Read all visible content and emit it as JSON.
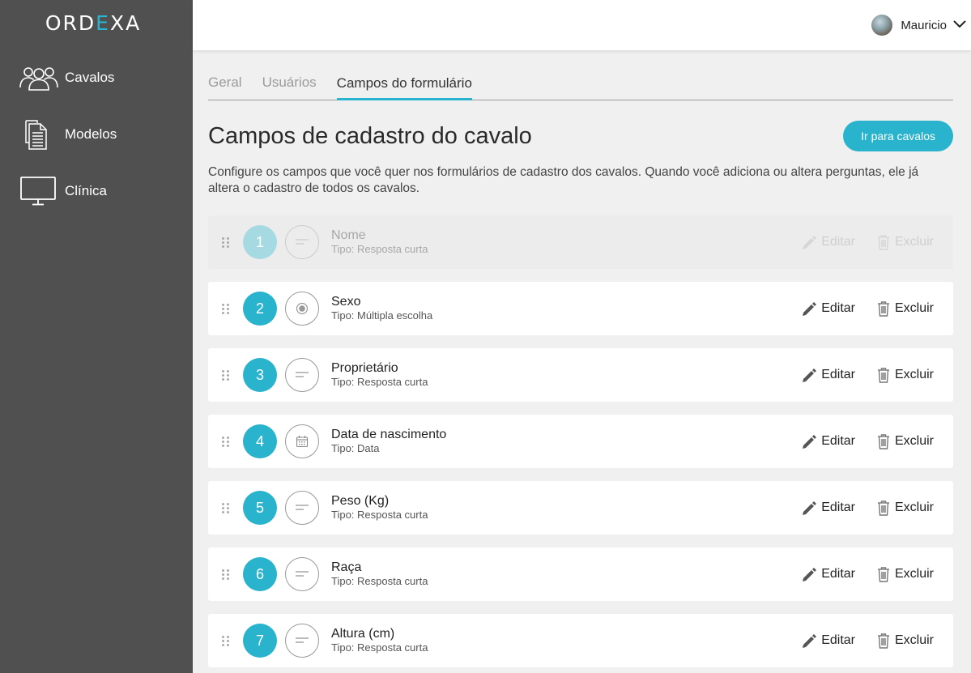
{
  "brand": {
    "logo_part1": "ORD",
    "logo_accent": "E",
    "logo_part2": "XA",
    "accent_color": "#29b3cc"
  },
  "sidebar": {
    "items": [
      {
        "label": "Cavalos",
        "icon": "users-icon"
      },
      {
        "label": "Modelos",
        "icon": "documents-icon"
      },
      {
        "label": "Clínica",
        "icon": "monitor-icon"
      }
    ]
  },
  "topbar": {
    "user_name": "Mauricio"
  },
  "tabs": [
    {
      "label": "Geral",
      "active": false
    },
    {
      "label": "Usuários",
      "active": false
    },
    {
      "label": "Campos do formulário",
      "active": true
    }
  ],
  "main": {
    "title": "Campos de cadastro do cavalo",
    "go_button": "Ir para cavalos",
    "description": "Configure os campos que você quer nos formulários de cadastro dos cavalos. Quando você adiciona ou altera perguntas, ele já altera o cadastro de todos os cavalos."
  },
  "actions": {
    "edit": "Editar",
    "delete": "Excluir"
  },
  "fields": [
    {
      "number": "1",
      "name": "Nome",
      "type": "Tipo: Resposta curta",
      "icon": "short-text-icon",
      "disabled": true
    },
    {
      "number": "2",
      "name": "Sexo",
      "type": "Tipo: Múltipla escolha",
      "icon": "radio-icon",
      "disabled": false
    },
    {
      "number": "3",
      "name": "Proprietário",
      "type": "Tipo: Resposta curta",
      "icon": "short-text-icon",
      "disabled": false
    },
    {
      "number": "4",
      "name": "Data de nascimento",
      "type": "Tipo: Data",
      "icon": "calendar-icon",
      "disabled": false
    },
    {
      "number": "5",
      "name": "Peso (Kg)",
      "type": "Tipo: Resposta curta",
      "icon": "short-text-icon",
      "disabled": false
    },
    {
      "number": "6",
      "name": "Raça",
      "type": "Tipo: Resposta curta",
      "icon": "short-text-icon",
      "disabled": false
    },
    {
      "number": "7",
      "name": "Altura (cm)",
      "type": "Tipo: Resposta curta",
      "icon": "short-text-icon",
      "disabled": false
    }
  ]
}
